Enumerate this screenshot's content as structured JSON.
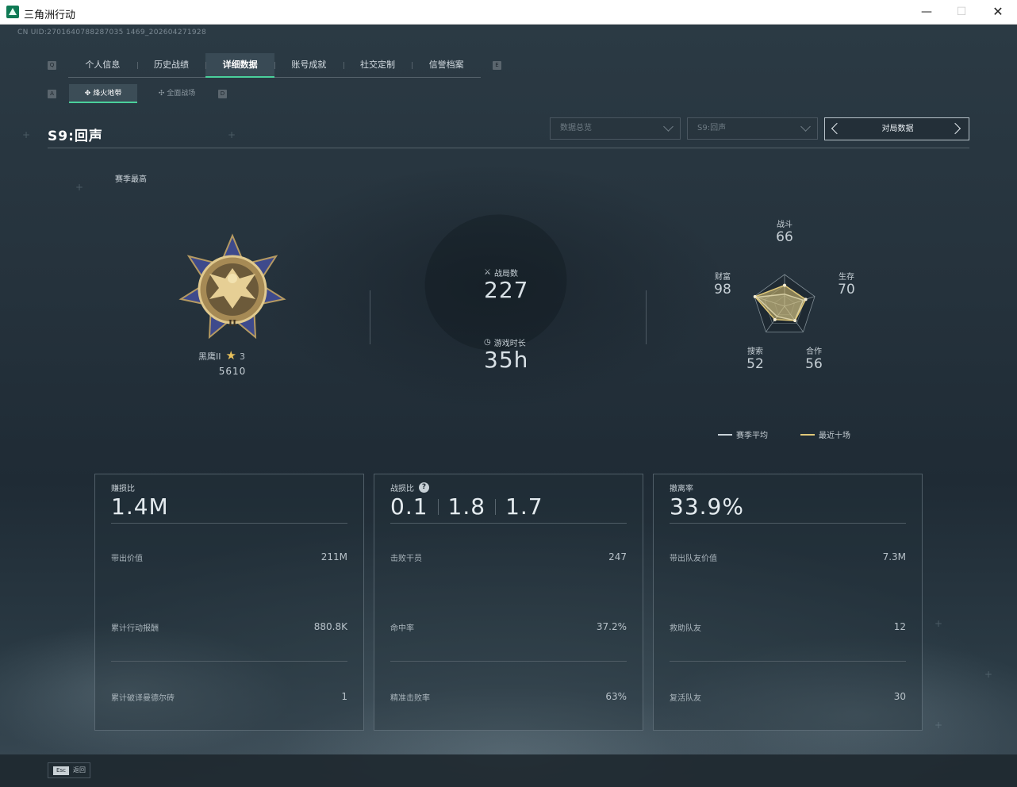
{
  "window": {
    "title": "三角洲行动",
    "minimize": "—",
    "maximize": "☐",
    "close": "✕"
  },
  "uid": "CN UID:2701640788287035 1469_202604271928",
  "tabs": {
    "left_key": "Q",
    "right_key": "E",
    "items": [
      {
        "label": "个人信息"
      },
      {
        "label": "历史战绩"
      },
      {
        "label": "详细数据",
        "active": true
      },
      {
        "label": "账号成就"
      },
      {
        "label": "社交定制"
      },
      {
        "label": "信誉档案"
      }
    ]
  },
  "subtabs": {
    "left_key": "A",
    "right_key": "D",
    "items": [
      {
        "label": "烽火地带",
        "active": true
      },
      {
        "label": "全面战场"
      }
    ]
  },
  "season_title": "S9:回声",
  "filters": {
    "dropdown1": "数据总览",
    "dropdown2": "S9:回声",
    "pager_label": "对局数据"
  },
  "season_best_label": "赛季最高",
  "rank": {
    "name": "黑鹰II",
    "stars": "3",
    "score": "5610",
    "badge_numeral": "II"
  },
  "stats": {
    "matches_label": "战局数",
    "matches_value": "227",
    "playtime_label": "游戏时长",
    "playtime_value": "35h"
  },
  "radar": {
    "axes": [
      {
        "label": "战斗",
        "value": "66"
      },
      {
        "label": "生存",
        "value": "70"
      },
      {
        "label": "合作",
        "value": "56"
      },
      {
        "label": "搜索",
        "value": "52"
      },
      {
        "label": "财富",
        "value": "98"
      }
    ],
    "legend_avg": "赛季平均",
    "legend_recent": "最近十场",
    "avg_color": "#c9d2d8",
    "recent_color": "#e0c879",
    "season_avg_values": [
      38,
      62,
      55,
      40,
      92
    ],
    "recent_values": [
      66,
      70,
      56,
      52,
      98
    ]
  },
  "cards": [
    {
      "title": "赚损比",
      "big": "1.4M",
      "rows": [
        {
          "label": "带出价值",
          "value": "211M"
        },
        {
          "label": "累计行动报酬",
          "value": "880.8K"
        },
        {
          "label": "累计破译曼德尔砖",
          "value": "1"
        }
      ]
    },
    {
      "title": "战损比",
      "help": "?",
      "bigs": [
        "0.1",
        "1.8",
        "1.7"
      ],
      "rows": [
        {
          "label": "击败干员",
          "value": "247"
        },
        {
          "label": "命中率",
          "value": "37.2%"
        },
        {
          "label": "精准击败率",
          "value": "63%"
        }
      ]
    },
    {
      "title": "撤离率",
      "big": "33.9%",
      "rows": [
        {
          "label": "带出队友价值",
          "value": "7.3M"
        },
        {
          "label": "救助队友",
          "value": "12"
        },
        {
          "label": "复活队友",
          "value": "30"
        }
      ]
    }
  ],
  "footer": {
    "esc_key": "Esc",
    "esc_label": "返回"
  }
}
